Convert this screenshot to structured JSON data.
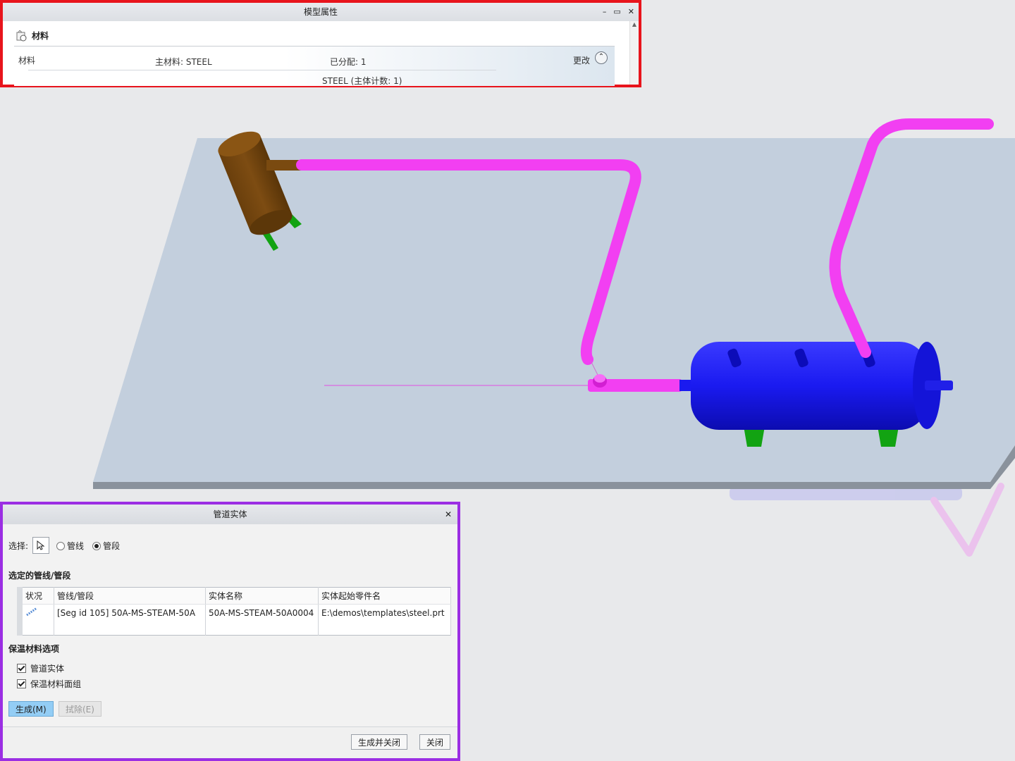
{
  "colors": {
    "pipe": "#f23ff2",
    "tank_blue": "#1a1af0",
    "brown_vessel": "#7a4a10",
    "support_green": "#12a312",
    "floor": "#c4d0de",
    "props_border": "#e8141c",
    "pipe_dialog_border": "#9b2ee3"
  },
  "model_props": {
    "title": "模型属性",
    "controls": {
      "minimize": "–",
      "maximize": "▭",
      "close": "✕"
    },
    "section_title": "材料",
    "section_icon": "material-icon",
    "row_label": "材料",
    "main_material": "主材料: STEEL",
    "assigned": "已分配: 1",
    "change": "更改",
    "collapse_icon": "chevron-up-icon",
    "detail": "STEEL (主体计数: 1)"
  },
  "pipe_solid": {
    "title": "管道实体",
    "close": "✕",
    "select_label": "选择:",
    "select_icon": "cursor-arrow-icon",
    "radio_pipeline": "管线",
    "radio_segment": "管段",
    "selected_radio": "管段",
    "selected_label": "选定的管线/管段",
    "columns": [
      "状况",
      "管线/管段",
      "实体名称",
      "实体起始零件名"
    ],
    "rows": [
      {
        "status_icon": "pipe-solid-icon",
        "segment": "[Seg id 105] 50A-MS-STEAM-50A",
        "solid_name": "50A-MS-STEAM-50A0004",
        "start_part": "E:\\demos\\templates\\steel.prt"
      }
    ],
    "insulation_label": "保温材料选项",
    "checkbox_pipe_solid": "管道实体",
    "checkbox_insulation": "保温材料面组",
    "generate": "生成(M)",
    "remove": "拭除(E)",
    "generate_close": "生成并关闭",
    "close_btn": "关闭"
  }
}
